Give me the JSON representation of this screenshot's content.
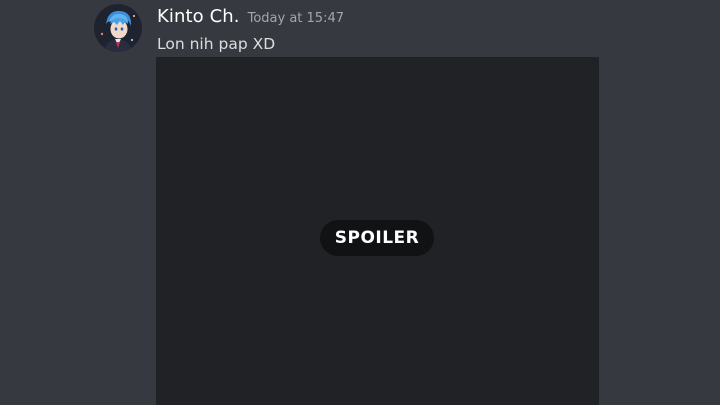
{
  "message": {
    "author": {
      "username": "Kinto Ch.",
      "avatar_icon": "anime-character-avatar"
    },
    "timestamp": "Today at 15:47",
    "content": "Lon nih pap XD",
    "attachment": {
      "spoiler_label": "SPOILER",
      "is_spoiler": true
    }
  },
  "colors": {
    "background": "#36393f",
    "attachment_background": "#202225",
    "spoiler_pill": "#111214",
    "username": "#ffffff",
    "timestamp": "#a3a6aa",
    "text": "#dcddde"
  }
}
